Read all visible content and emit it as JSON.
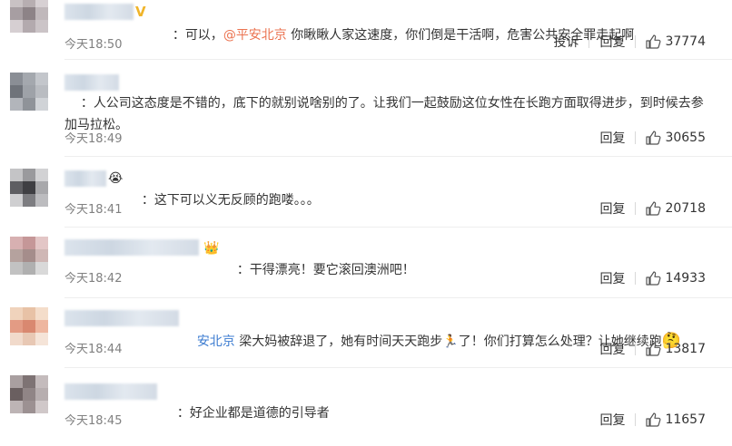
{
  "comments": [
    {
      "nick_badge": "V",
      "colon": "：",
      "text_before": "可以，",
      "mention": "@平安北京",
      "text_after": " 你瞅瞅人家这速度，你们倒是干活啊，危害公共安全罪走起啊",
      "time": "今天18:50",
      "report_label": "投诉",
      "reply_label": "回复",
      "likes": "37774",
      "avatar_colors": [
        "#c9c2c4",
        "#b7aeb1",
        "#d7d0d3",
        "#a79ea2",
        "#8d8387",
        "#c0b8bb",
        "#d6cfd2",
        "#b3aaae",
        "#cbc4c7"
      ]
    },
    {
      "colon": "：",
      "text": "人公司这态度是不错的，底下的就别说啥别的了。让我们一起鼓励这位女性在长跑方面取得进步，到时候去参加马拉松。",
      "time": "今天18:49",
      "reply_label": "回复",
      "likes": "30655",
      "avatar_colors": [
        "#8a8e95",
        "#a4a8ae",
        "#c3c6cb",
        "#6f737a",
        "#9ea2a8",
        "#b9bcc1",
        "#b2b5bb",
        "#8f9399",
        "#d0d3d7"
      ]
    },
    {
      "emoji": "😭",
      "colon": "：",
      "text": "这下可以义无反顾的跑喽。。。",
      "time": "今天18:41",
      "reply_label": "回复",
      "likes": "20718",
      "avatar_colors": [
        "#c4c4c6",
        "#9a9a9d",
        "#d2d2d4",
        "#5e5e62",
        "#3f3f43",
        "#a8a8ab",
        "#cfcfd1",
        "#7d7d81",
        "#bcbcbf"
      ]
    },
    {
      "emoji": "👑",
      "colon": "：",
      "text": "干得漂亮！要它滚回澳洲吧！",
      "time": "今天18:42",
      "reply_label": "回复",
      "likes": "14933",
      "avatar_colors": [
        "#d7b0b1",
        "#c59798",
        "#e3c6c6",
        "#b5a29e",
        "#a58d8b",
        "#cfb7b5",
        "#c2c2c2",
        "#b0b0b0",
        "#d9d9d9"
      ]
    },
    {
      "brand_fragment": "安北京",
      "text_before": " 梁大妈被辞退了，她有时间天天跑步",
      "runner": "🏃",
      "text_after": "了！你们打算怎么处理？让她继续跑",
      "thinking": "🤔",
      "time": "今天18:44",
      "reply_label": "回复",
      "likes": "13817",
      "avatar_colors": [
        "#f0d3bc",
        "#e8c2a6",
        "#f4ddca",
        "#e39b84",
        "#d98870",
        "#eeb69f",
        "#f1dacb",
        "#e8c8b4",
        "#f5e4d8"
      ]
    },
    {
      "colon": "：",
      "text": "好企业都是道德的引导者",
      "time": "今天18:45",
      "reply_label": "回复",
      "likes": "11657",
      "avatar_colors": [
        "#a99fa0",
        "#7e7374",
        "#c4bbbc",
        "#6a5f60",
        "#908586",
        "#b7aeaf",
        "#bdb4b5",
        "#9c9192",
        "#d0c8c9"
      ]
    }
  ]
}
